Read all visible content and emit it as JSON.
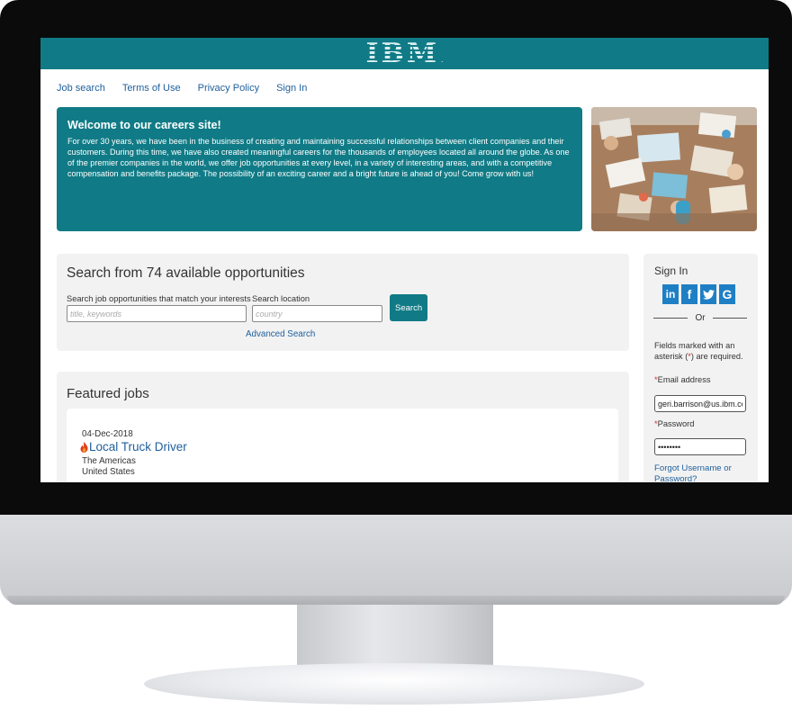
{
  "brand": {
    "logo_text": "IBM",
    "logo_mark": ".",
    "accent": "#107b86",
    "link": "#1f5f9c"
  },
  "nav": [
    {
      "label": "Job search"
    },
    {
      "label": "Terms of Use"
    },
    {
      "label": "Privacy Policy"
    },
    {
      "label": "Sign In"
    }
  ],
  "hero": {
    "title": "Welcome to our careers site!",
    "body": "For over 30 years, we have been in the business of creating and maintaining successful relationships between client companies and their customers. During this time, we have also created meaningful careers for the thousands of employees located all around the globe. As one of the premier companies in the world, we offer job opportunities at every level, in a variety of interesting areas, and with a competitive compensation and benefits package. The possibility of an exciting career and a bright future is ahead of you! Come grow with us!"
  },
  "search": {
    "title": "Search from 74 available opportunities",
    "keywords_label": "Search job opportunities that match your interests",
    "keywords_placeholder": "title, keywords",
    "location_label": "Search location",
    "location_placeholder": "country",
    "button_label": "Search",
    "advanced_link": "Advanced Search"
  },
  "featured": {
    "title": "Featured jobs",
    "jobs": [
      {
        "date": "04-Dec-2018",
        "title": "Local Truck Driver",
        "region": "The Americas",
        "country": "United States"
      }
    ]
  },
  "signin": {
    "title": "Sign In",
    "social": [
      {
        "icon": "linkedin-icon",
        "glyph": "in"
      },
      {
        "icon": "facebook-icon",
        "glyph": "f"
      },
      {
        "icon": "twitter-icon",
        "glyph": "t"
      },
      {
        "icon": "google-icon",
        "glyph": "G"
      }
    ],
    "or_text": "Or",
    "note_before": "Fields marked with an asterisk (",
    "note_asterisk": "*",
    "note_after": ") are required.",
    "email_label": "Email address",
    "email_value": "geri.barrison@us.ibm.com",
    "password_label": "Password",
    "password_value": "••••••••",
    "required_mark": "*",
    "forgot_link": "Forgot Username or Password?"
  }
}
